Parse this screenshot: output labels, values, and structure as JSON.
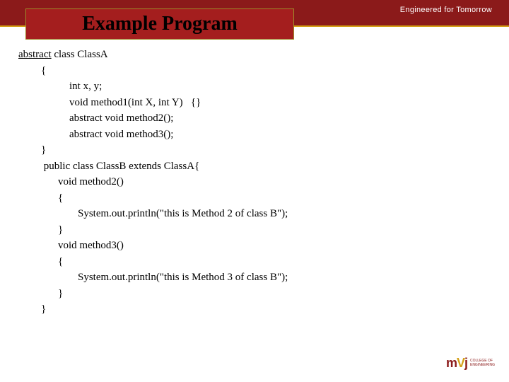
{
  "header": {
    "tagline": "Engineered for Tomorrow",
    "title": "Example Program"
  },
  "code": {
    "l01a": "abstract",
    "l01b": " class ClassA",
    "l02": "{",
    "l03": "int x, y;",
    "l04": "void method1(int X, int Y)   {}",
    "l05": "abstract void method2();",
    "l06": "abstract void method3();",
    "l07": "}",
    "l08": " public class ClassB extends ClassA{",
    "l09": "void method2()",
    "l10": "{",
    "l11": "System.out.println(\"this is Method 2 of class B\");",
    "l12": "}",
    "l13": "void method3()",
    "l14": "{",
    "l15": "System.out.println(\"this is Method 3 of class B\");",
    "l16": "}",
    "l17": "}"
  },
  "logo": {
    "brand": "m",
    "brandV": "V",
    "brandJ": "j",
    "line1": "COLLEGE OF",
    "line2": "ENGINEERING"
  }
}
